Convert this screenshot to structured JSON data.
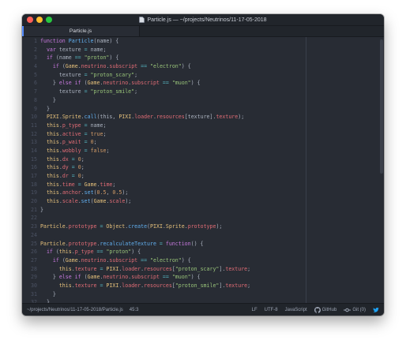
{
  "window": {
    "title": "Particle.js — ~/projects/Neutrinos/11-17-05-2018"
  },
  "tabs": [
    {
      "label": "Particle.js"
    }
  ],
  "icons": {
    "file": "file-icon",
    "github": "github-icon",
    "git": "git-commit-icon",
    "twitter": "twitter-icon"
  },
  "colors": {
    "keyword": "#c678dd",
    "function": "#61afef",
    "string": "#98c379",
    "number": "#d19a66",
    "property": "#e06c75",
    "class": "#e5c07b",
    "text": "#abb2bf",
    "operator": "#56b6c2",
    "background": "#282c34",
    "accent": "#528bff"
  },
  "code": [
    {
      "n": "1",
      "t": [
        [
          "kw",
          "function "
        ],
        [
          "fn",
          "Particle"
        ],
        [
          "punc",
          "(name) {"
        ]
      ]
    },
    {
      "n": "2",
      "t": [
        [
          "punc",
          "  "
        ],
        [
          "kw",
          "var "
        ],
        [
          "id",
          "texture "
        ],
        [
          "op",
          "= "
        ],
        [
          "id",
          "name;"
        ]
      ]
    },
    {
      "n": "3",
      "t": [
        [
          "punc",
          "  "
        ],
        [
          "kw",
          "if "
        ],
        [
          "punc",
          "(name "
        ],
        [
          "op",
          "== "
        ],
        [
          "str",
          "\"proton\""
        ],
        [
          "punc",
          ") {"
        ]
      ]
    },
    {
      "n": "4",
      "t": [
        [
          "punc",
          "    "
        ],
        [
          "kw",
          "if "
        ],
        [
          "punc",
          "("
        ],
        [
          "cls",
          "Game"
        ],
        [
          "punc",
          "."
        ],
        [
          "prop",
          "neutrino"
        ],
        [
          "punc",
          "."
        ],
        [
          "prop",
          "subscript "
        ],
        [
          "op",
          "== "
        ],
        [
          "str",
          "\"electron\""
        ],
        [
          "punc",
          ") {"
        ]
      ]
    },
    {
      "n": "5",
      "t": [
        [
          "punc",
          "      "
        ],
        [
          "id",
          "texture "
        ],
        [
          "op",
          "= "
        ],
        [
          "str",
          "\"proton_scary\""
        ],
        [
          "punc",
          ";"
        ]
      ]
    },
    {
      "n": "6",
      "t": [
        [
          "punc",
          "    } "
        ],
        [
          "kw",
          "else if "
        ],
        [
          "punc",
          "("
        ],
        [
          "cls",
          "Game"
        ],
        [
          "punc",
          "."
        ],
        [
          "prop",
          "neutrino"
        ],
        [
          "punc",
          "."
        ],
        [
          "prop",
          "subscript "
        ],
        [
          "op",
          "== "
        ],
        [
          "str",
          "\"muon\""
        ],
        [
          "punc",
          ") {"
        ]
      ]
    },
    {
      "n": "7",
      "t": [
        [
          "punc",
          "      "
        ],
        [
          "id",
          "texture "
        ],
        [
          "op",
          "= "
        ],
        [
          "str",
          "\"proton_smile\""
        ],
        [
          "punc",
          ";"
        ]
      ]
    },
    {
      "n": "8",
      "t": [
        [
          "punc",
          "    }"
        ]
      ]
    },
    {
      "n": "9",
      "t": [
        [
          "punc",
          "  }"
        ]
      ]
    },
    {
      "n": "10",
      "t": [
        [
          "punc",
          "  "
        ],
        [
          "cls",
          "PIXI"
        ],
        [
          "punc",
          "."
        ],
        [
          "cls",
          "Sprite"
        ],
        [
          "punc",
          "."
        ],
        [
          "fn",
          "call"
        ],
        [
          "punc",
          "(this, "
        ],
        [
          "cls",
          "PIXI"
        ],
        [
          "punc",
          "."
        ],
        [
          "prop",
          "loader"
        ],
        [
          "punc",
          "."
        ],
        [
          "prop",
          "resources"
        ],
        [
          "punc",
          "[texture]."
        ],
        [
          "prop",
          "texture"
        ],
        [
          "punc",
          ");"
        ]
      ]
    },
    {
      "n": "11",
      "t": [
        [
          "punc",
          "  "
        ],
        [
          "this",
          "this"
        ],
        [
          "punc",
          "."
        ],
        [
          "prop",
          "p_type "
        ],
        [
          "op",
          "= "
        ],
        [
          "id",
          "name;"
        ]
      ]
    },
    {
      "n": "12",
      "t": [
        [
          "punc",
          "  "
        ],
        [
          "this",
          "this"
        ],
        [
          "punc",
          "."
        ],
        [
          "prop",
          "active "
        ],
        [
          "op",
          "= "
        ],
        [
          "num",
          "true"
        ],
        [
          "punc",
          ";"
        ]
      ]
    },
    {
      "n": "13",
      "t": [
        [
          "punc",
          "  "
        ],
        [
          "this",
          "this"
        ],
        [
          "punc",
          "."
        ],
        [
          "prop",
          "p_wait "
        ],
        [
          "op",
          "= "
        ],
        [
          "num",
          "0"
        ],
        [
          "punc",
          ";"
        ]
      ]
    },
    {
      "n": "14",
      "t": [
        [
          "punc",
          "  "
        ],
        [
          "this",
          "this"
        ],
        [
          "punc",
          "."
        ],
        [
          "prop",
          "wobbly "
        ],
        [
          "op",
          "= "
        ],
        [
          "num",
          "false"
        ],
        [
          "punc",
          ";"
        ]
      ]
    },
    {
      "n": "15",
      "t": [
        [
          "punc",
          "  "
        ],
        [
          "this",
          "this"
        ],
        [
          "punc",
          "."
        ],
        [
          "prop",
          "dx "
        ],
        [
          "op",
          "= "
        ],
        [
          "num",
          "0"
        ],
        [
          "punc",
          ";"
        ]
      ]
    },
    {
      "n": "16",
      "t": [
        [
          "punc",
          "  "
        ],
        [
          "this",
          "this"
        ],
        [
          "punc",
          "."
        ],
        [
          "prop",
          "dy "
        ],
        [
          "op",
          "= "
        ],
        [
          "num",
          "0"
        ],
        [
          "punc",
          ";"
        ]
      ]
    },
    {
      "n": "17",
      "t": [
        [
          "punc",
          "  "
        ],
        [
          "this",
          "this"
        ],
        [
          "punc",
          "."
        ],
        [
          "prop",
          "dr "
        ],
        [
          "op",
          "= "
        ],
        [
          "num",
          "0"
        ],
        [
          "punc",
          ";"
        ]
      ]
    },
    {
      "n": "18",
      "t": [
        [
          "punc",
          "  "
        ],
        [
          "this",
          "this"
        ],
        [
          "punc",
          "."
        ],
        [
          "prop",
          "time "
        ],
        [
          "op",
          "= "
        ],
        [
          "cls",
          "Game"
        ],
        [
          "punc",
          "."
        ],
        [
          "prop",
          "time"
        ],
        [
          "punc",
          ";"
        ]
      ]
    },
    {
      "n": "19",
      "t": [
        [
          "punc",
          "  "
        ],
        [
          "this",
          "this"
        ],
        [
          "punc",
          "."
        ],
        [
          "prop",
          "anchor"
        ],
        [
          "punc",
          "."
        ],
        [
          "fn",
          "set"
        ],
        [
          "punc",
          "("
        ],
        [
          "num",
          "0.5"
        ],
        [
          "punc",
          ", "
        ],
        [
          "num",
          "0.5"
        ],
        [
          "punc",
          ");"
        ]
      ]
    },
    {
      "n": "20",
      "t": [
        [
          "punc",
          "  "
        ],
        [
          "this",
          "this"
        ],
        [
          "punc",
          "."
        ],
        [
          "prop",
          "scale"
        ],
        [
          "punc",
          "."
        ],
        [
          "fn",
          "set"
        ],
        [
          "punc",
          "("
        ],
        [
          "cls",
          "Game"
        ],
        [
          "punc",
          "."
        ],
        [
          "prop",
          "scale"
        ],
        [
          "punc",
          ");"
        ]
      ]
    },
    {
      "n": "21",
      "t": [
        [
          "punc",
          "}"
        ]
      ]
    },
    {
      "n": "22",
      "t": []
    },
    {
      "n": "23",
      "t": [
        [
          "cls",
          "Particle"
        ],
        [
          "punc",
          "."
        ],
        [
          "prop",
          "prototype "
        ],
        [
          "op",
          "= "
        ],
        [
          "cls",
          "Object"
        ],
        [
          "punc",
          "."
        ],
        [
          "fn",
          "create"
        ],
        [
          "punc",
          "("
        ],
        [
          "cls",
          "PIXI"
        ],
        [
          "punc",
          "."
        ],
        [
          "cls",
          "Sprite"
        ],
        [
          "punc",
          "."
        ],
        [
          "prop",
          "prototype"
        ],
        [
          "punc",
          ");"
        ]
      ]
    },
    {
      "n": "24",
      "t": []
    },
    {
      "n": "25",
      "t": [
        [
          "cls",
          "Particle"
        ],
        [
          "punc",
          "."
        ],
        [
          "prop",
          "prototype"
        ],
        [
          "punc",
          "."
        ],
        [
          "fn",
          "recalculateTexture "
        ],
        [
          "op",
          "= "
        ],
        [
          "kw",
          "function"
        ],
        [
          "punc",
          "() {"
        ]
      ]
    },
    {
      "n": "26",
      "t": [
        [
          "punc",
          "  "
        ],
        [
          "kw",
          "if "
        ],
        [
          "punc",
          "("
        ],
        [
          "this",
          "this"
        ],
        [
          "punc",
          "."
        ],
        [
          "prop",
          "p_type "
        ],
        [
          "op",
          "== "
        ],
        [
          "str",
          "\"proton\""
        ],
        [
          "punc",
          ") {"
        ]
      ]
    },
    {
      "n": "27",
      "t": [
        [
          "punc",
          "    "
        ],
        [
          "kw",
          "if "
        ],
        [
          "punc",
          "("
        ],
        [
          "cls",
          "Game"
        ],
        [
          "punc",
          "."
        ],
        [
          "prop",
          "neutrino"
        ],
        [
          "punc",
          "."
        ],
        [
          "prop",
          "subscript "
        ],
        [
          "op",
          "== "
        ],
        [
          "str",
          "\"electron\""
        ],
        [
          "punc",
          ") {"
        ]
      ]
    },
    {
      "n": "28",
      "t": [
        [
          "punc",
          "      "
        ],
        [
          "this",
          "this"
        ],
        [
          "punc",
          "."
        ],
        [
          "prop",
          "texture "
        ],
        [
          "op",
          "= "
        ],
        [
          "cls",
          "PIXI"
        ],
        [
          "punc",
          "."
        ],
        [
          "prop",
          "loader"
        ],
        [
          "punc",
          "."
        ],
        [
          "prop",
          "resources"
        ],
        [
          "punc",
          "["
        ],
        [
          "str",
          "\"proton_scary\""
        ],
        [
          "punc",
          "]."
        ],
        [
          "prop",
          "texture"
        ],
        [
          "punc",
          ";"
        ]
      ]
    },
    {
      "n": "29",
      "t": [
        [
          "punc",
          "    } "
        ],
        [
          "kw",
          "else if "
        ],
        [
          "punc",
          "("
        ],
        [
          "cls",
          "Game"
        ],
        [
          "punc",
          "."
        ],
        [
          "prop",
          "neutrino"
        ],
        [
          "punc",
          "."
        ],
        [
          "prop",
          "subscript "
        ],
        [
          "op",
          "== "
        ],
        [
          "str",
          "\"muon\""
        ],
        [
          "punc",
          ") {"
        ]
      ]
    },
    {
      "n": "30",
      "t": [
        [
          "punc",
          "      "
        ],
        [
          "this",
          "this"
        ],
        [
          "punc",
          "."
        ],
        [
          "prop",
          "texture "
        ],
        [
          "op",
          "= "
        ],
        [
          "cls",
          "PIXI"
        ],
        [
          "punc",
          "."
        ],
        [
          "prop",
          "loader"
        ],
        [
          "punc",
          "."
        ],
        [
          "prop",
          "resources"
        ],
        [
          "punc",
          "["
        ],
        [
          "str",
          "\"proton_smile\""
        ],
        [
          "punc",
          "]."
        ],
        [
          "prop",
          "texture"
        ],
        [
          "punc",
          ";"
        ]
      ]
    },
    {
      "n": "31",
      "t": [
        [
          "punc",
          "    }"
        ]
      ]
    },
    {
      "n": "32",
      "t": [
        [
          "punc",
          "  }"
        ]
      ]
    }
  ],
  "status": {
    "path": "~/projects/Neutrinos/11-17-05-2018/Particle.js",
    "cursor": "45:3",
    "line_ending": "LF",
    "encoding": "UTF-8",
    "grammar": "JavaScript",
    "github": "GitHub",
    "git": "Git (0)"
  }
}
